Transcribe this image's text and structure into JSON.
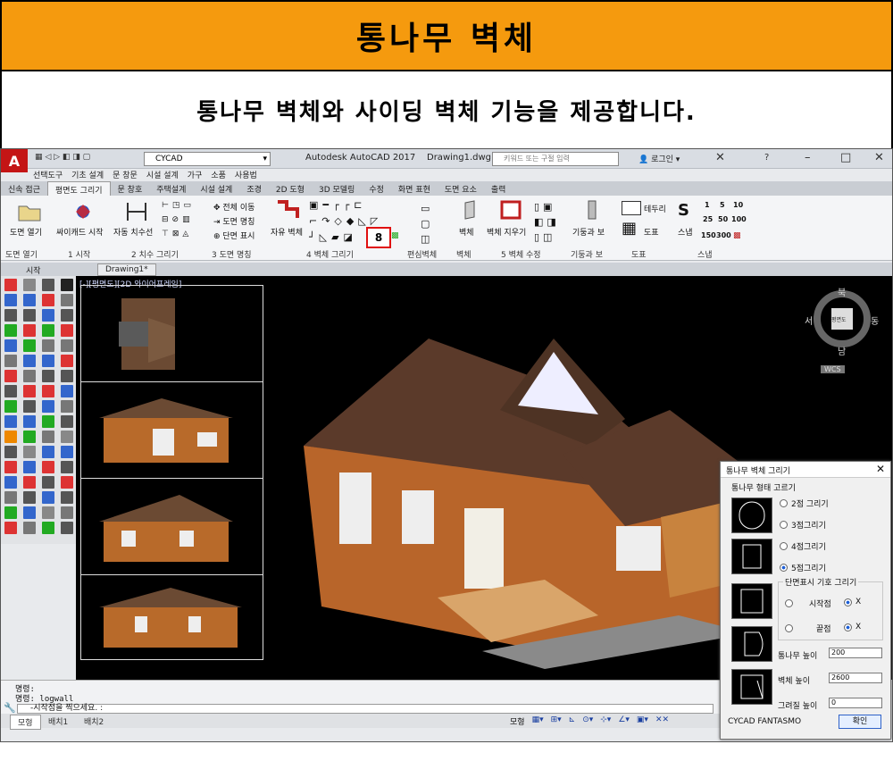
{
  "banner": {
    "title": "통나무 벽체"
  },
  "subtitle": "통나무 벽체와 사이딩 벽체 기능을 제공합니다.",
  "app": {
    "logo": "A",
    "workspace": "CYCAD",
    "title": "Autodesk AutoCAD 2017",
    "file": "Drawing1.dwg",
    "search_placeholder": "키워드 또는 구절 입력",
    "login": "로그인",
    "help": "?"
  },
  "menu": [
    "선택도구",
    "기초 설계",
    "문 창문",
    "시설 설계",
    "가구",
    "소품",
    "사용법"
  ],
  "tabs": [
    "신속 접근",
    "평면도 그리기",
    "문 창호",
    "주택설계",
    "시설 설계",
    "조경",
    "2D 도형",
    "3D 모델링",
    "수정",
    "화면 표현",
    "도면 요소",
    "출력"
  ],
  "ribbon": {
    "open_drawing": "도면 열기",
    "cycad_start": "싸이캐드 시작",
    "auto_dim": "자동 치수선",
    "move_all": "전체 이동",
    "drawing_name": "도면 명칭",
    "section_mark": "단면 표시",
    "free_wall": "자유 벽체",
    "edit_wall": "편심벽체",
    "wall": "벽체",
    "wall_erase": "벽체 지우기",
    "column_beam": "기둥과 보",
    "border": "테두리",
    "form": "도표",
    "snap": "스냅",
    "snap_nums": [
      "1",
      "5",
      "10",
      "25",
      "50",
      "100",
      "150",
      "300"
    ],
    "highlight_icon": "8"
  },
  "panels": [
    "도면 열기",
    "1 시작",
    "2 치수 그리기",
    "3 도면 명칭",
    "4 벽체 그리기",
    "편심벽체",
    "벽체",
    "5 벽체 수정",
    "기둥과 보",
    "도표",
    "스냅"
  ],
  "doctabs": [
    "시작",
    "Drawing1*"
  ],
  "viewport": {
    "label": "[-][평면도][2D 와이어프레임]",
    "compass": {
      "n": "북",
      "s": "남",
      "e": "동",
      "w": "서",
      "center": "평면도"
    },
    "wcs": "WCS"
  },
  "command": {
    "lines": [
      "명령:",
      "명령: logwall"
    ],
    "prompt": "-시작점을 찍으세요. :"
  },
  "layouts": [
    "모형",
    "배치1",
    "배치2"
  ],
  "status_model": "모형",
  "dialog": {
    "title": "통나무 벽체 그리기",
    "group_shape": "통나무 형태 고르기",
    "options": [
      "2점 그리기",
      "3점그리기",
      "4점그리기",
      "5점그리기"
    ],
    "selected_option": 3,
    "group_section": "단면표시 기호 그리기",
    "start_label": "시작점",
    "end_label": "끝점",
    "x_label": "X",
    "log_height_label": "통나무 높이",
    "log_height": "200",
    "wall_height_label": "벽체 높이",
    "wall_height": "2600",
    "draw_height_label": "그려질 높이",
    "draw_height": "0",
    "footer": "CYCAD FANTASMO",
    "ok": "확인"
  },
  "colors": {
    "banner": "#f59a0e",
    "viewport": "#000000",
    "accent": "#c41515"
  }
}
